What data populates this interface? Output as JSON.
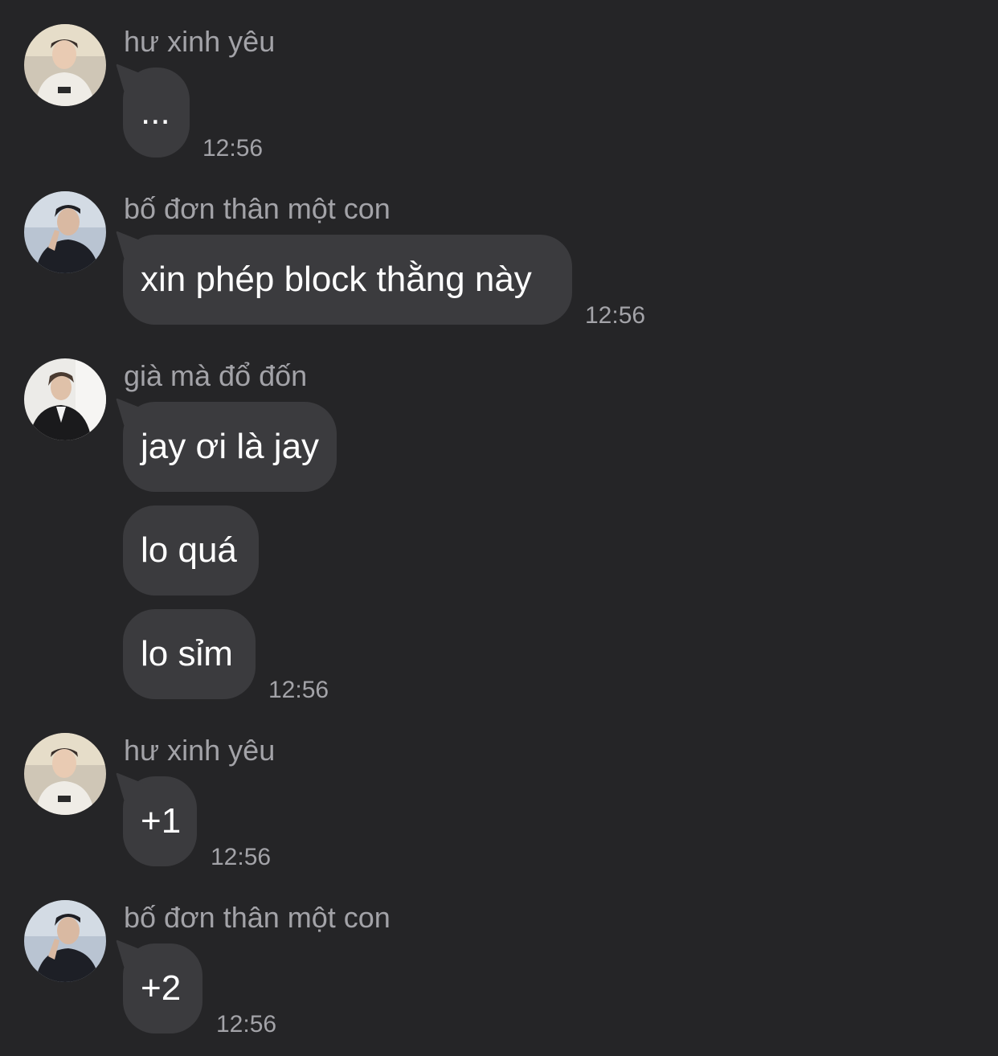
{
  "messages": [
    {
      "sender": "hư xinh yêu",
      "avatar": "avatar-hu-xinh-yeu",
      "bubbles": [
        "..."
      ],
      "time": "12:56"
    },
    {
      "sender": "bố đơn thân một con",
      "avatar": "avatar-bo-don-than-mot-con",
      "bubbles": [
        "xin phép block thằng này"
      ],
      "time": "12:56"
    },
    {
      "sender": "già mà đổ đốn",
      "avatar": "avatar-gia-ma-do-don",
      "bubbles": [
        "jay ơi là jay",
        "lo quá",
        "lo sỉm"
      ],
      "time": "12:56"
    },
    {
      "sender": "hư xinh yêu",
      "avatar": "avatar-hu-xinh-yeu",
      "bubbles": [
        "+1"
      ],
      "time": "12:56"
    },
    {
      "sender": "bố đơn thân một con",
      "avatar": "avatar-bo-don-than-mot-con",
      "bubbles": [
        "+2"
      ],
      "time": "12:56"
    }
  ],
  "colors": {
    "background": "#252527",
    "bubble": "#3b3b3e",
    "text": "#ffffff",
    "secondary_text": "#a3a3a8"
  }
}
